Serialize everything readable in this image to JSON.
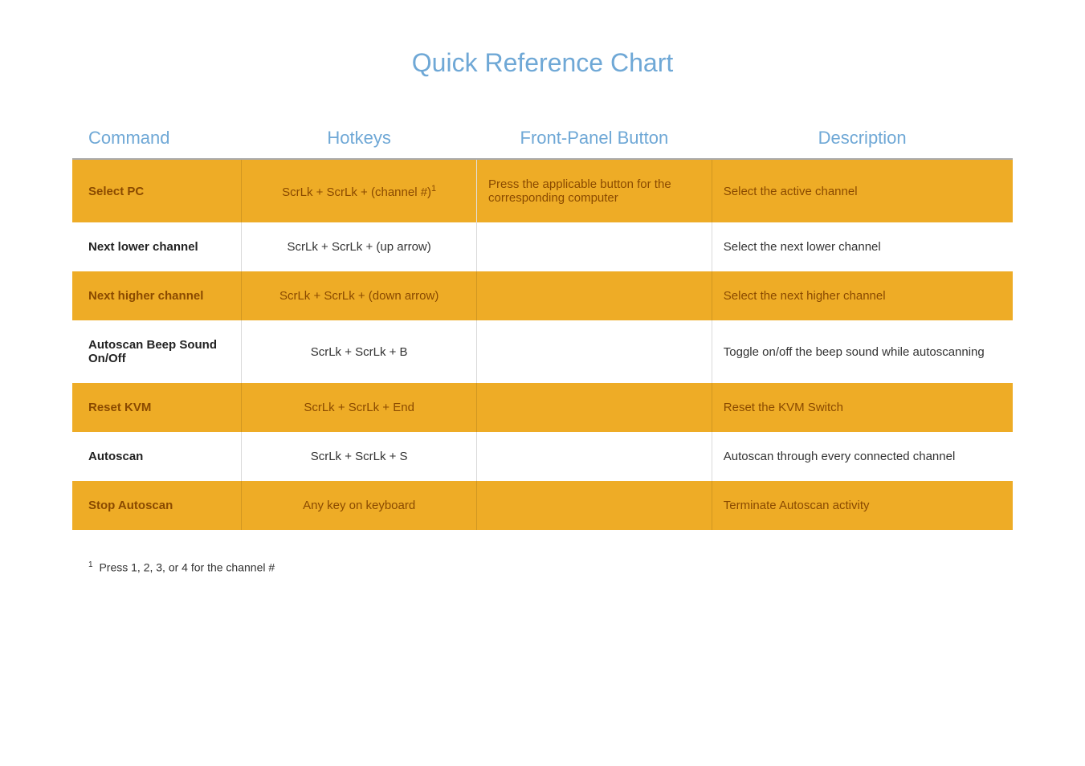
{
  "title": "Quick Reference Chart",
  "columns": {
    "command": "Command",
    "hotkeys": "Hotkeys",
    "front_panel": "Front-Panel Button",
    "description": "Description"
  },
  "rows": [
    {
      "command": "Select PC",
      "hotkeys": "ScrLk + ScrLk + (channel #)",
      "hotkeys_sup": "1",
      "front_panel": "Press the applicable button for the corresponding computer",
      "description": "Select the active channel",
      "highlighted": true
    },
    {
      "command": "Next lower channel",
      "hotkeys": "ScrLk + ScrLk + (up arrow)",
      "hotkeys_sup": "",
      "front_panel": "",
      "description": "Select the next lower channel",
      "highlighted": false
    },
    {
      "command": "Next higher channel",
      "hotkeys": "ScrLk + ScrLk + (down arrow)",
      "hotkeys_sup": "",
      "front_panel": "",
      "description": "Select the next higher channel",
      "highlighted": true
    },
    {
      "command": "Autoscan Beep Sound On/Off",
      "hotkeys": "ScrLk + ScrLk + B",
      "hotkeys_sup": "",
      "front_panel": "",
      "description": "Toggle on/off the beep sound while autoscanning",
      "highlighted": false
    },
    {
      "command": "Reset KVM",
      "hotkeys": "ScrLk + ScrLk + End",
      "hotkeys_sup": "",
      "front_panel": "",
      "description": "Reset the KVM Switch",
      "highlighted": true
    },
    {
      "command": "Autoscan",
      "hotkeys": "ScrLk + ScrLk + S",
      "hotkeys_sup": "",
      "front_panel": "",
      "description": "Autoscan through every connected channel",
      "highlighted": false
    },
    {
      "command": "Stop Autoscan",
      "hotkeys": "Any key on keyboard",
      "hotkeys_sup": "",
      "front_panel": "",
      "description": "Terminate Autoscan activity",
      "highlighted": true
    }
  ],
  "footnote": {
    "marker": "1",
    "text": "Press 1, 2, 3, or 4 for the channel #"
  }
}
